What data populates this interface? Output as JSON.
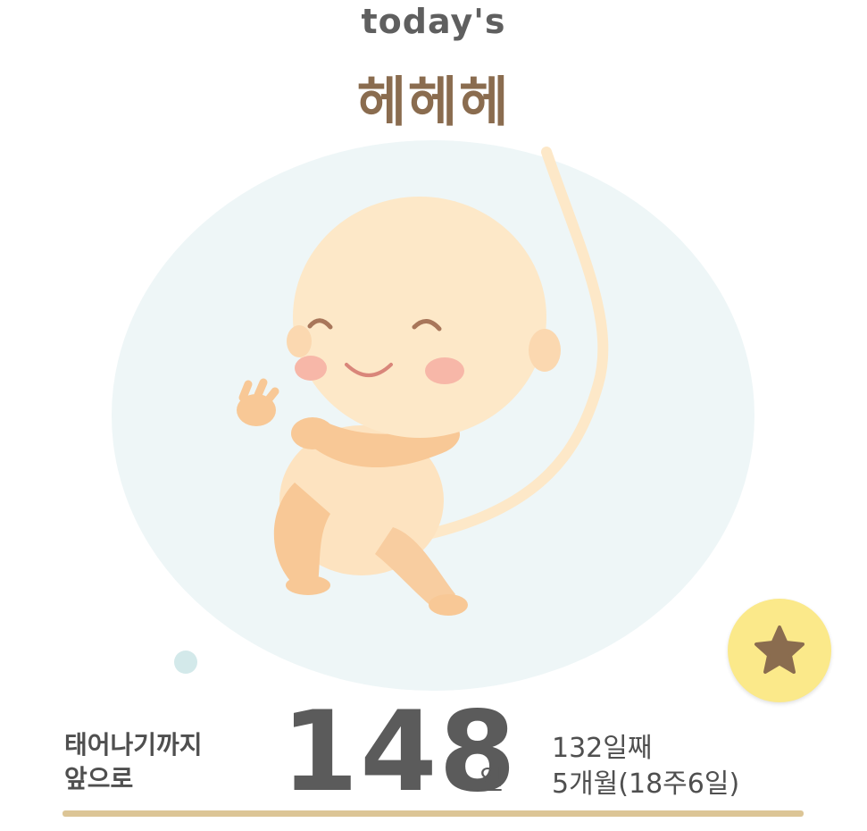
{
  "header": {
    "subtitle": "today's",
    "baby_name": "헤헤헤"
  },
  "countdown": {
    "label_line1": "태어나기까지",
    "label_line2": "앞으로",
    "days_remaining": "148",
    "unit": "일"
  },
  "progress": {
    "day_count": "132일째",
    "month_week": "5개월(18주6일)"
  },
  "actions": {
    "favorite_icon": "star-icon"
  },
  "colors": {
    "accent_brown": "#8a6c4f",
    "star_bg": "#fbe98a",
    "bar": "#dcc596",
    "bubble": "#eef6f7"
  }
}
